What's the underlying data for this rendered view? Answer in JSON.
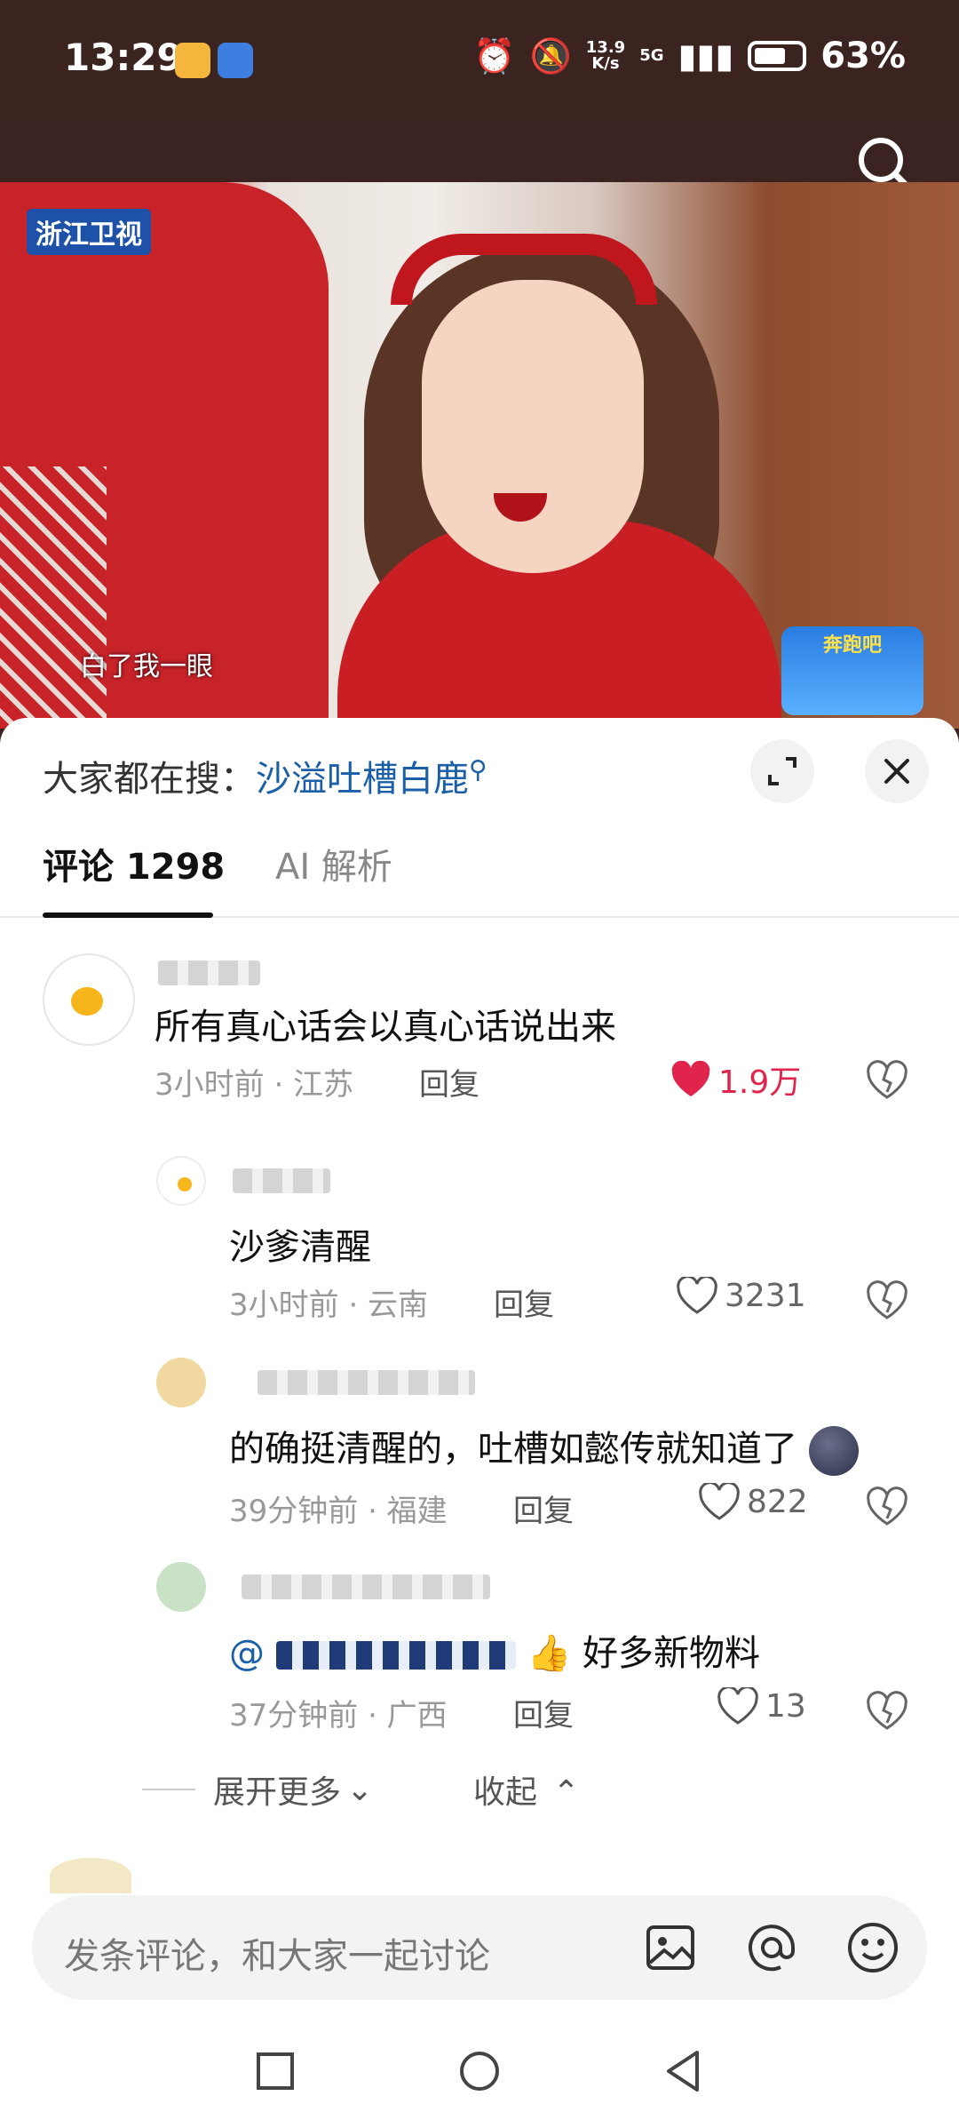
{
  "status_bar": {
    "time": "13:29",
    "network_speed": "13.9\nK/s",
    "network_type": "5G",
    "battery": "63%"
  },
  "video": {
    "channel_watermark": "浙江卫视",
    "subtitle": "白了我一眼",
    "show_logo": "奔跑吧"
  },
  "sheet": {
    "hot_search_prefix": "大家都在搜：",
    "hot_search_keyword": "沙溢吐槽白鹿",
    "tabs": [
      {
        "label": "评论 1298"
      },
      {
        "label": "AI 解析"
      }
    ]
  },
  "comments": [
    {
      "text": "所有真心话会以真心话说出来",
      "meta": "3小时前 · 江苏",
      "reply": "回复",
      "likes": "1.9万",
      "liked": true
    },
    {
      "text": "沙爹清醒",
      "meta": "3小时前 · 云南",
      "reply": "回复",
      "likes": "3231",
      "liked": false
    },
    {
      "text": "的确挺清醒的，吐槽如懿传就知道了",
      "meta": "39分钟前 · 福建",
      "reply": "回复",
      "likes": "822",
      "liked": false
    },
    {
      "text_prefix": "@",
      "text_suffix": "好多新物料",
      "meta": "37分钟前 · 广西",
      "reply": "回复",
      "likes": "13",
      "liked": false
    }
  ],
  "thread_controls": {
    "expand_more": "展开更多",
    "collapse": "收起"
  },
  "input_bar": {
    "placeholder": "发条评论，和大家一起讨论"
  },
  "icons": {
    "search": "search-icon",
    "expand": "expand-icon",
    "close": "close-icon",
    "heart": "heart-icon",
    "dislike": "broken-heart-icon",
    "image": "image-icon",
    "at": "at-icon",
    "emoji": "emoji-icon"
  },
  "colors": {
    "accent_red": "#e0244c",
    "link_blue": "#1a5fa8"
  }
}
